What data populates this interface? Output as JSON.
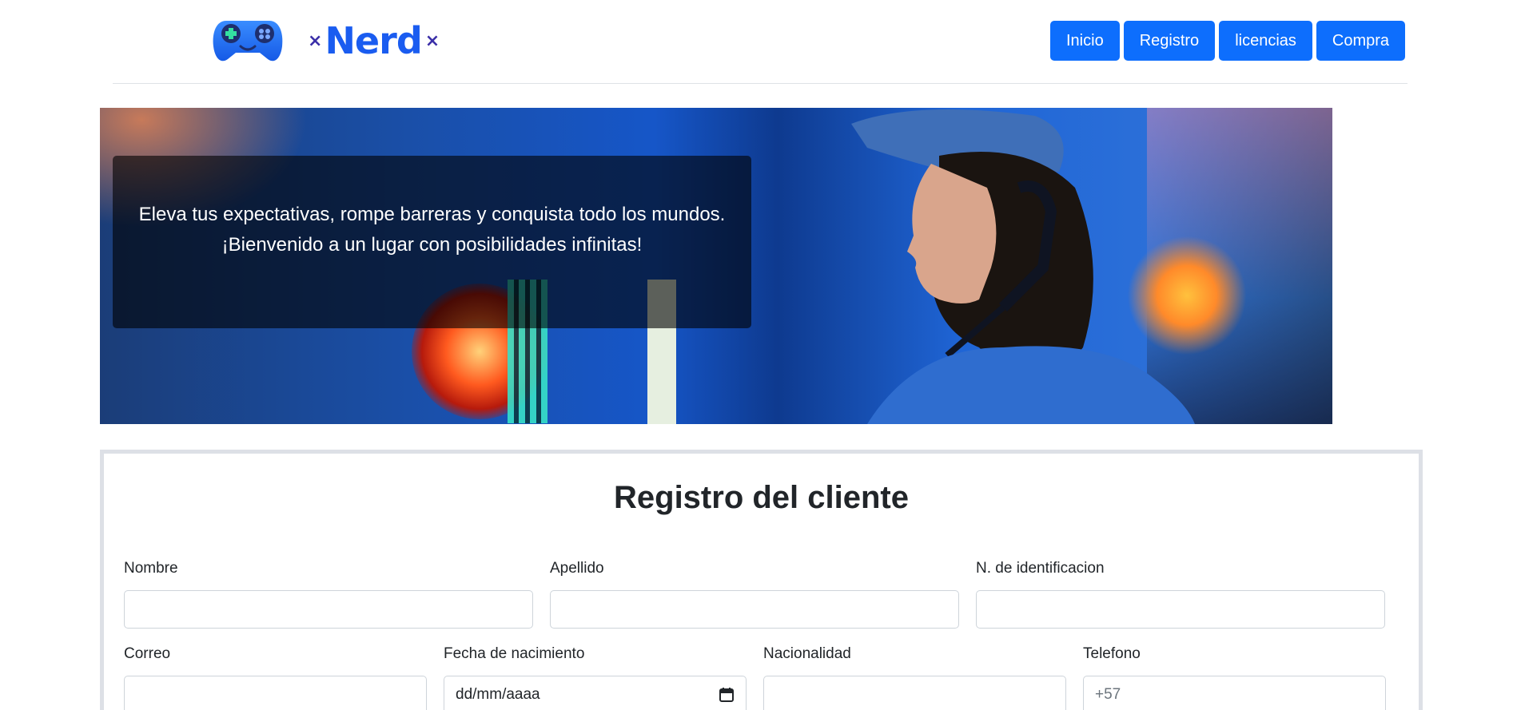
{
  "brand": {
    "name": "Nerd",
    "left_mark": "×",
    "right_mark": "×"
  },
  "nav": {
    "items": [
      {
        "label": "Inicio"
      },
      {
        "label": "Registro"
      },
      {
        "label": "licencias"
      },
      {
        "label": "Compra"
      }
    ]
  },
  "hero": {
    "line1": "Eleva tus expectativas, rompe barreras y conquista todo los mundos.",
    "line2": "¡Bienvenido a un lugar con posibilidades infinitas!"
  },
  "form": {
    "title": "Registro del cliente",
    "fields": {
      "nombre": {
        "label": "Nombre",
        "value": ""
      },
      "apellido": {
        "label": "Apellido",
        "value": ""
      },
      "identificacion": {
        "label": "N. de identificacion",
        "value": ""
      },
      "correo": {
        "label": "Correo",
        "value": ""
      },
      "fecha": {
        "label": "Fecha de nacimiento",
        "placeholder": "dd/mm/aaaa"
      },
      "nacionalidad": {
        "label": "Nacionalidad",
        "value": ""
      },
      "telefono": {
        "label": "Telefono",
        "placeholder": "+57"
      }
    }
  },
  "colors": {
    "primary": "#0d6efd",
    "brand_blue": "#1a5cf0",
    "card_border": "#dde0e6"
  }
}
